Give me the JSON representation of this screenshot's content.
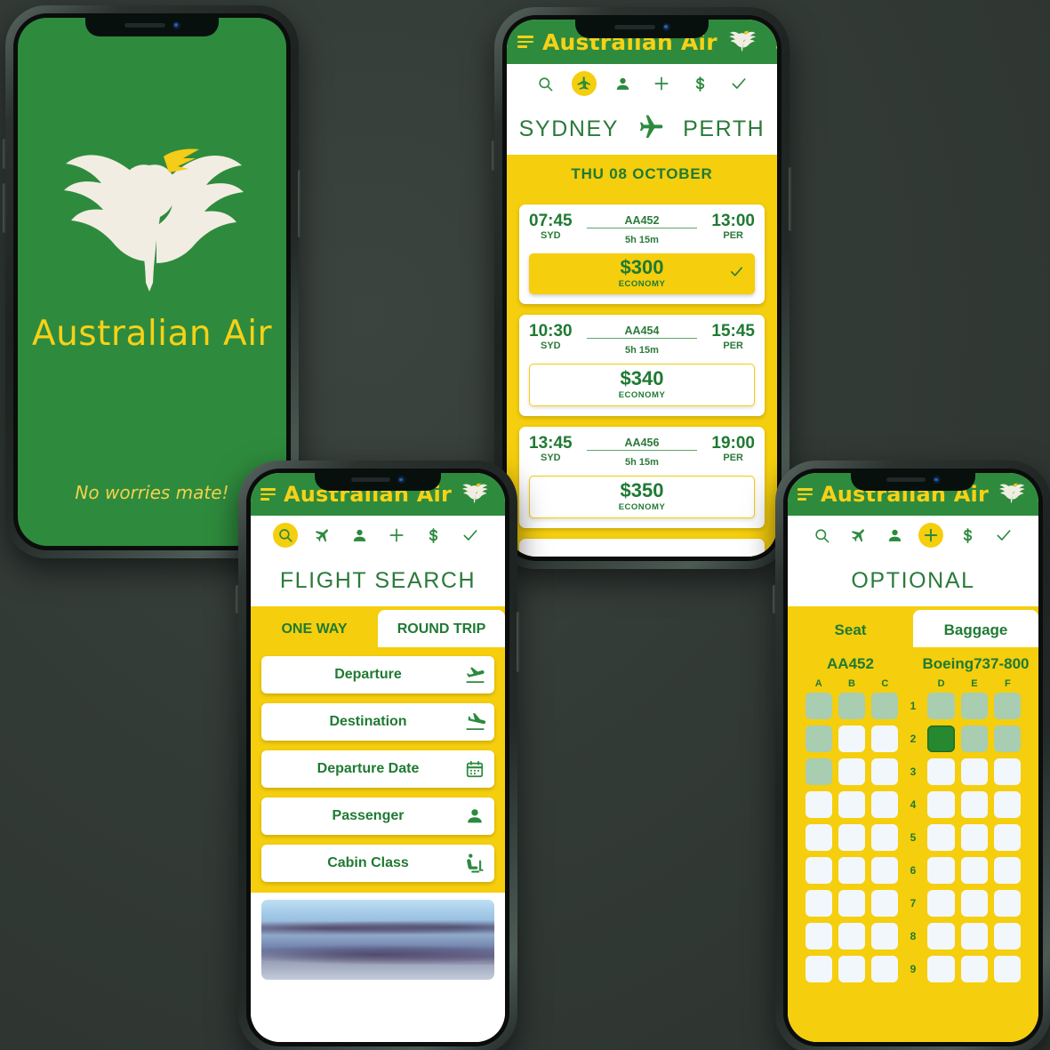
{
  "theme": {
    "green": "#2e8b3d",
    "dark_green": "#1f7a33",
    "yellow": "#f5ce0d",
    "logo_yellow": "#f7d117",
    "background": "#343c38",
    "seat_occupied": "#a8cdb0",
    "seat_free": "#f2f7fb",
    "seat_selected": "#27892f"
  },
  "app": {
    "brand": "Australian Air",
    "menu_icon": "hamburger-icon",
    "overflow_icon": "kebab-menu-icon",
    "logo_icon": "bird-logo-icon"
  },
  "nav_icons": [
    {
      "name": "search-icon",
      "label": "Search"
    },
    {
      "name": "flight-icon",
      "label": "Flights"
    },
    {
      "name": "person-icon",
      "label": "Passenger"
    },
    {
      "name": "plus-icon",
      "label": "Optional"
    },
    {
      "name": "dollar-icon",
      "label": "Payment"
    },
    {
      "name": "check-icon",
      "label": "Confirm"
    }
  ],
  "splash": {
    "brand": "Australian Air",
    "tagline": "No worries mate!"
  },
  "flights_screen": {
    "active_nav": "flight-icon",
    "origin": "SYDNEY",
    "destination": "PERTH",
    "route_icon": "plane-icon",
    "date": "THU 08 OCTOBER",
    "flights": [
      {
        "depart_time": "07:45",
        "depart_code": "SYD",
        "flight_no": "AA452",
        "duration": "5h 15m",
        "arrive_time": "13:00",
        "arrive_code": "PER",
        "price": "$300",
        "cabin": "ECONOMY",
        "selected": true
      },
      {
        "depart_time": "10:30",
        "depart_code": "SYD",
        "flight_no": "AA454",
        "duration": "5h 15m",
        "arrive_time": "15:45",
        "arrive_code": "PER",
        "price": "$340",
        "cabin": "ECONOMY",
        "selected": false
      },
      {
        "depart_time": "13:45",
        "depart_code": "SYD",
        "flight_no": "AA456",
        "duration": "5h 15m",
        "arrive_time": "19:00",
        "arrive_code": "PER",
        "price": "$350",
        "cabin": "ECONOMY",
        "selected": false
      }
    ]
  },
  "search_screen": {
    "active_nav": "search-icon",
    "title": "FLIGHT SEARCH",
    "trip_tabs": [
      {
        "label": "ONE WAY",
        "active": true
      },
      {
        "label": "ROUND TRIP",
        "active": false
      }
    ],
    "fields": [
      {
        "label": "Departure",
        "icon": "takeoff-icon"
      },
      {
        "label": "Destination",
        "icon": "landing-icon"
      },
      {
        "label": "Departure Date",
        "icon": "calendar-icon"
      },
      {
        "label": "Passenger",
        "icon": "person-icon"
      },
      {
        "label": "Cabin Class",
        "icon": "seat-icon"
      }
    ],
    "hero_image": "sky-clouds-photo"
  },
  "seat_screen": {
    "active_nav": "plus-icon",
    "title": "OPTIONAL",
    "option_tabs": [
      {
        "label": "Seat",
        "active": true
      },
      {
        "label": "Baggage",
        "active": false
      }
    ],
    "flight_no": "AA452",
    "aircraft": "Boeing737-800",
    "columns": [
      "A",
      "B",
      "C",
      "D",
      "E",
      "F"
    ],
    "rows": [
      {
        "number": "1",
        "seats": [
          "occupied",
          "occupied",
          "occupied",
          "occupied",
          "occupied",
          "occupied"
        ]
      },
      {
        "number": "2",
        "seats": [
          "occupied",
          "free",
          "free",
          "selected",
          "occupied",
          "occupied"
        ]
      },
      {
        "number": "3",
        "seats": [
          "occupied",
          "free",
          "free",
          "free",
          "free",
          "free"
        ]
      },
      {
        "number": "4",
        "seats": [
          "free",
          "free",
          "free",
          "free",
          "free",
          "free"
        ]
      },
      {
        "number": "5",
        "seats": [
          "free",
          "free",
          "free",
          "free",
          "free",
          "free"
        ]
      },
      {
        "number": "6",
        "seats": [
          "free",
          "free",
          "free",
          "free",
          "free",
          "free"
        ]
      },
      {
        "number": "7",
        "seats": [
          "free",
          "free",
          "free",
          "free",
          "free",
          "free"
        ]
      },
      {
        "number": "8",
        "seats": [
          "free",
          "free",
          "free",
          "free",
          "free",
          "free"
        ]
      },
      {
        "number": "9",
        "seats": [
          "free",
          "free",
          "free",
          "free",
          "free",
          "free"
        ]
      }
    ]
  }
}
